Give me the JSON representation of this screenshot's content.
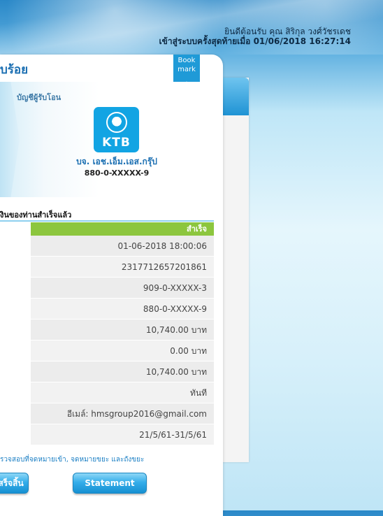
{
  "header": {
    "greeting_line1": "ยินดีต้อนรับ คุณ สิริกุล วงศ์วัชรเดช",
    "greeting_line2": "เข้าสู่ระบบครั้งสุดท้ายเมื่อ 01/06/2018 16:27:14"
  },
  "page": {
    "title": "บร้อย",
    "bookmark_line1": "Book",
    "bookmark_line2": "mark"
  },
  "recipient": {
    "label": "บัญชีผู้รับโอน",
    "bank_logo_text": "KTB",
    "account_name": "บจ. เอช.เอ็ม.เอส.กรุ๊ป",
    "account_number": "880-0-XXXXX-9"
  },
  "transfer": {
    "section_title": "งินของท่านสำเร็จแล้ว",
    "status": "สำเร็จ",
    "rows": [
      "01-06-2018 18:00:06",
      "2317712657201861",
      "909-0-XXXXX-3",
      "880-0-XXXXX-9",
      "10,740.00 บาท",
      "0.00 บาท",
      "10,740.00 บาท",
      "ทันที",
      "อีเมล์: hmsgroup2016@gmail.com",
      "21/5/61-31/5/61"
    ],
    "note": "รวจสอบที่จดหมายเข้า, จดหมายขยะ และถังขยะ"
  },
  "buttons": {
    "left_label": "เสร็จสิ้น",
    "statement_label": "Statement"
  },
  "colors": {
    "accent_blue": "#1b6fb2",
    "success_green": "#8cc63e",
    "ktb_blue": "#12a4e3"
  }
}
